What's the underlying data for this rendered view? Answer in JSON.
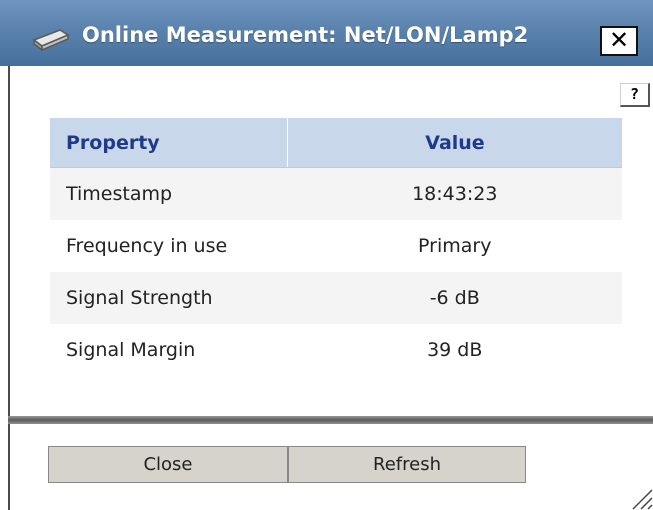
{
  "window": {
    "title": "Online Measurement: Net/LON/Lamp2",
    "close_symbol": "✕",
    "help_label": "?",
    "icon": "window-icon"
  },
  "table": {
    "headers": [
      "Property",
      "Value"
    ],
    "rows": [
      [
        "Timestamp",
        "18:43:23"
      ],
      [
        "Frequency in use",
        "Primary"
      ],
      [
        "Signal Strength",
        "-6 dB"
      ],
      [
        "Signal Margin",
        "39 dB"
      ]
    ]
  },
  "footer": {
    "close_label": "Close",
    "refresh_label": "Refresh"
  },
  "colors": {
    "titlebar": "#5a82ad",
    "header_bg": "#c8d8ea",
    "header_text": "#1f3a8a",
    "button_bg": "#d6d3cc"
  }
}
